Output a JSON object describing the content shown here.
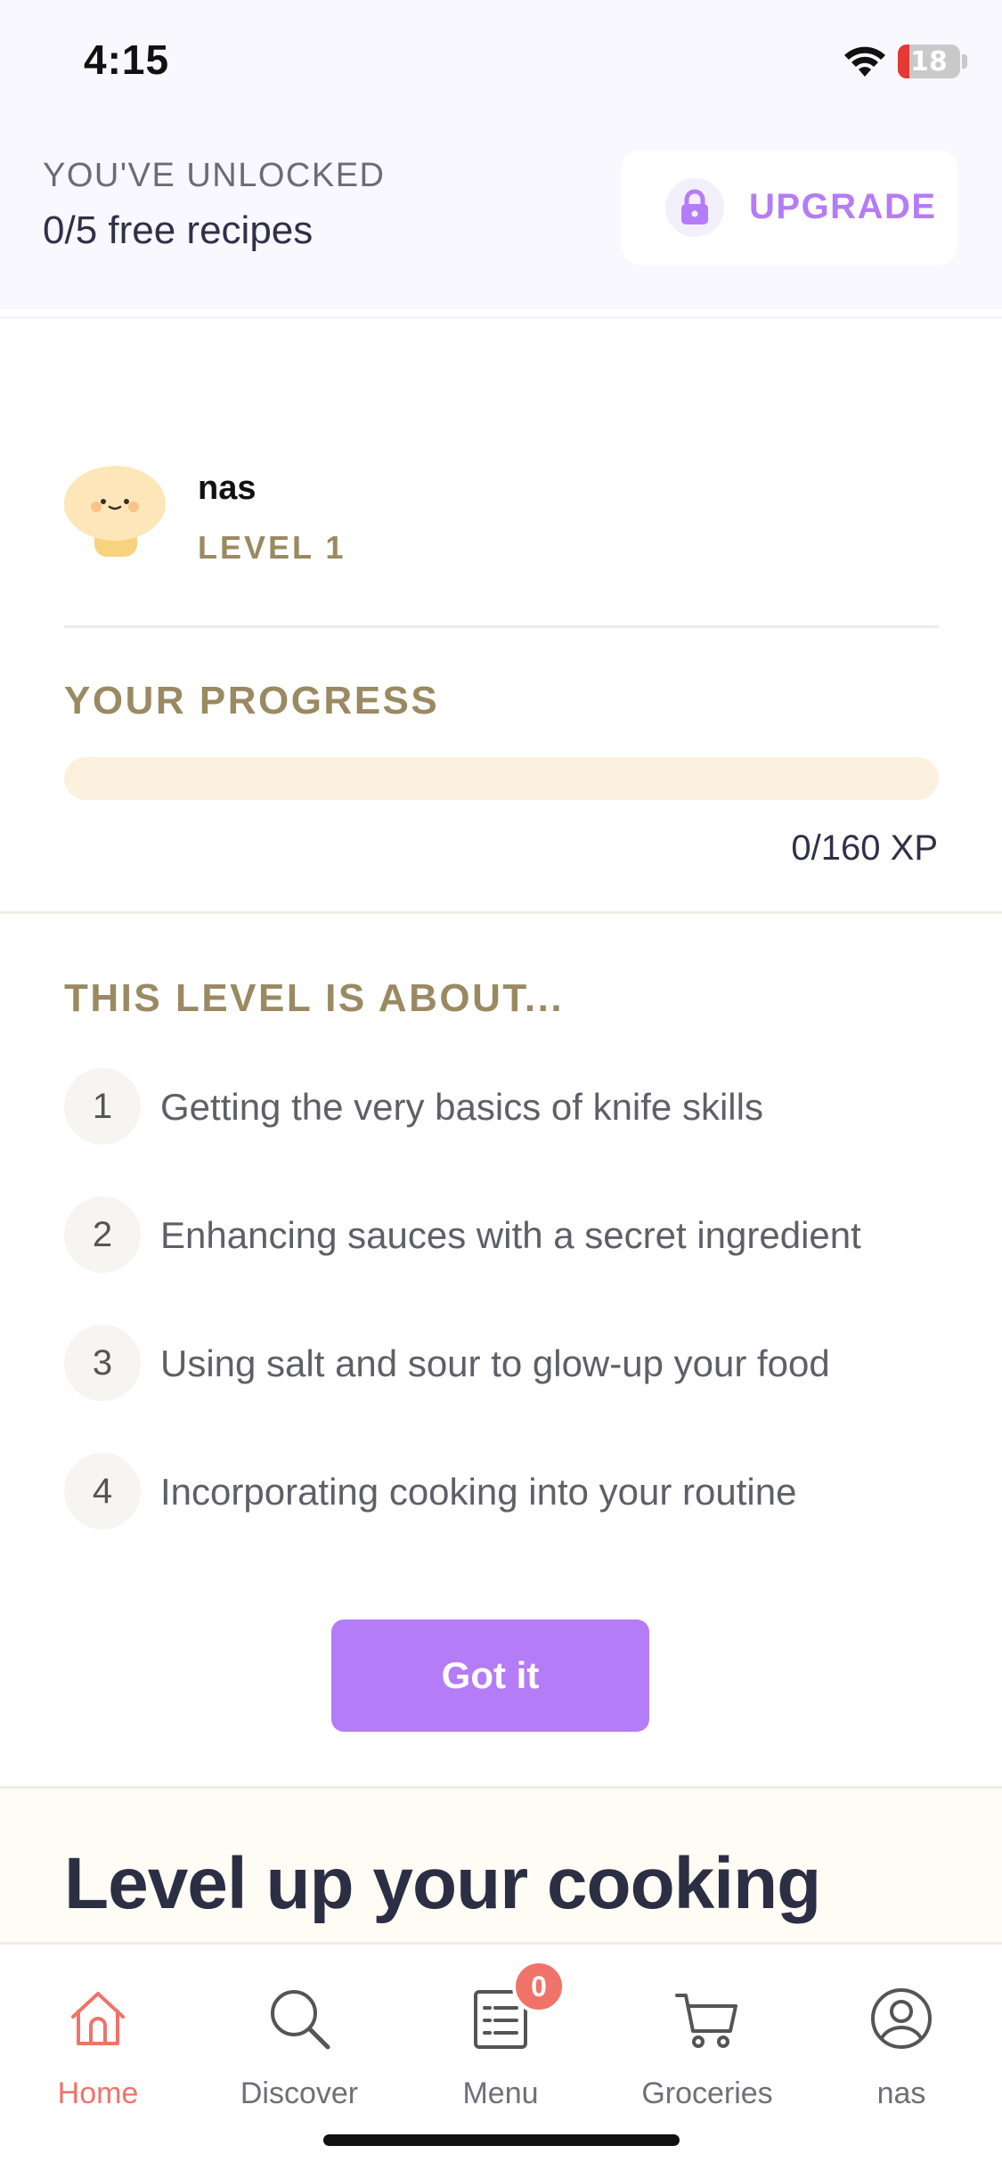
{
  "status_bar": {
    "time": "4:15",
    "battery": "18",
    "battery_level": 0.18,
    "icons": [
      "wifi-icon",
      "battery-icon"
    ]
  },
  "banner": {
    "unlock_label": "YOU'VE UNLOCKED",
    "unlock_count": "0/5 free recipes",
    "upgrade_label": "UPGRADE",
    "upgrade_icon": "lock-icon",
    "accent_color": "#b57cf7"
  },
  "profile": {
    "name": "nas",
    "level": "LEVEL 1",
    "avatar_icon": "mushroom-avatar-icon"
  },
  "progress": {
    "title": "YOUR PROGRESS",
    "xp_text": "0/160 XP",
    "xp_current": 0,
    "xp_total": 160
  },
  "level_about": {
    "title": "THIS LEVEL IS ABOUT...",
    "items": [
      {
        "num": "1",
        "text": "Getting the very basics of knife skills"
      },
      {
        "num": "2",
        "text": "Enhancing sauces with a secret ingredient"
      },
      {
        "num": "3",
        "text": "Using salt and sour to glow-up your food"
      },
      {
        "num": "4",
        "text": "Incorporating cooking into your routine"
      }
    ],
    "button_label": "Got it"
  },
  "next_section": {
    "heading": "Level up your cooking"
  },
  "tab_bar": {
    "tabs": [
      {
        "label": "Home",
        "icon": "home-icon",
        "active": true
      },
      {
        "label": "Discover",
        "icon": "search-icon",
        "active": false
      },
      {
        "label": "Menu",
        "icon": "menu-list-icon",
        "active": false,
        "badge": "0"
      },
      {
        "label": "Groceries",
        "icon": "cart-icon",
        "active": false
      },
      {
        "label": "nas",
        "icon": "profile-icon",
        "active": false
      }
    ],
    "active_color": "#f0736a"
  }
}
